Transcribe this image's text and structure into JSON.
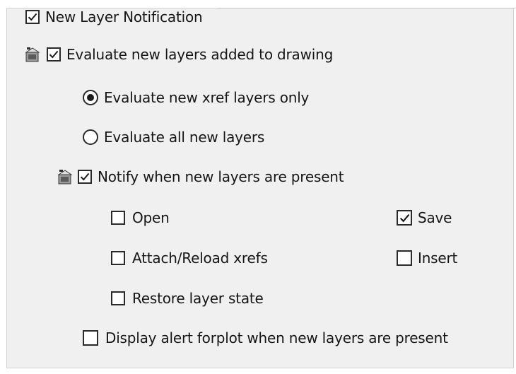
{
  "new_layer_notification": {
    "label": "New Layer Notification",
    "checked": true
  },
  "evaluate_new_layers": {
    "label": "Evaluate new layers added to drawing",
    "checked": true,
    "icon": "layer-state-icon"
  },
  "evaluate_options": [
    {
      "label": "Evaluate new xref layers only",
      "selected": true
    },
    {
      "label": "Evaluate all new layers",
      "selected": false
    }
  ],
  "notify_when_present": {
    "label": "Notify when new layers are present",
    "checked": true,
    "icon": "layer-state-icon"
  },
  "notify_events": {
    "open": {
      "label": "Open",
      "checked": false
    },
    "attach_reload_xrefs": {
      "label": "Attach/Reload xrefs",
      "checked": false
    },
    "restore_layer_state": {
      "label": "Restore layer state",
      "checked": false
    },
    "save": {
      "label": "Save",
      "checked": true
    },
    "insert": {
      "label": "Insert",
      "checked": false
    }
  },
  "display_alert_for_plot": {
    "label": "Display alert forplot when new layers are present",
    "checked": false
  },
  "colors": {
    "panel_background": "#f0f0f0",
    "check_border": "#2a2a2a",
    "text": "#161616"
  }
}
